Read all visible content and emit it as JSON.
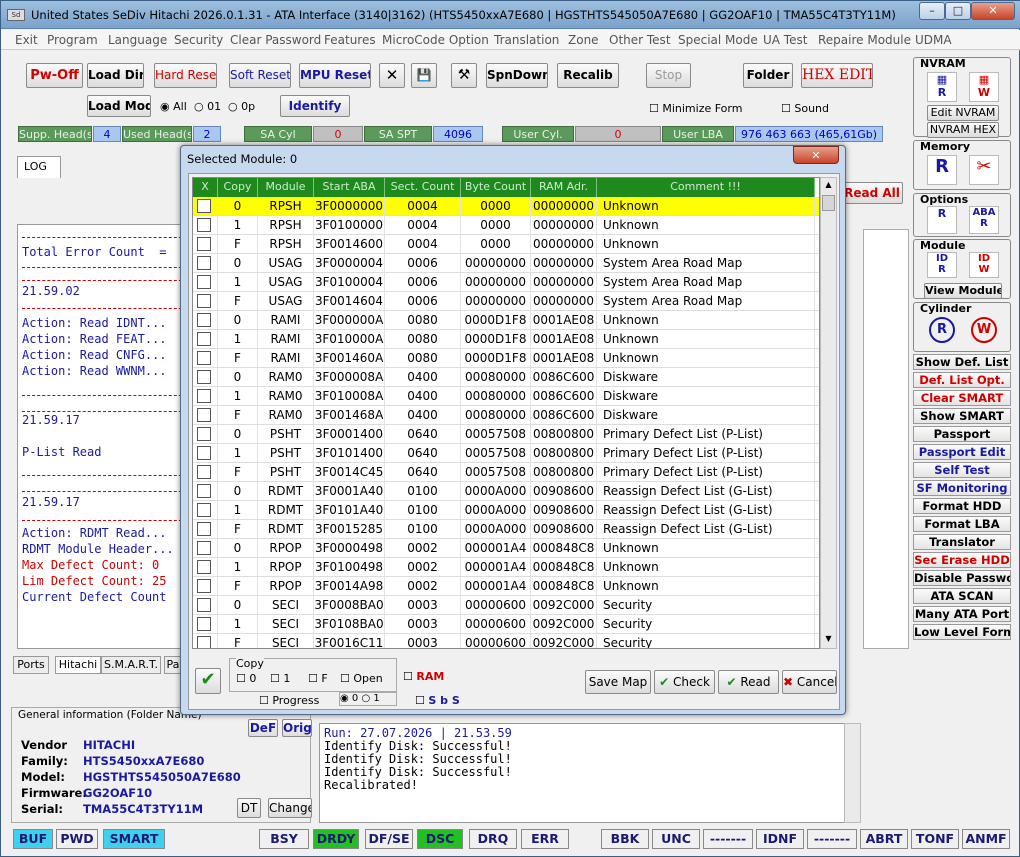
{
  "window": {
    "title": "United States  SeDiv Hitachi  2026.0.1.31 - ATA Interface  (3140|3162) (HTS5450xxA7E680 | HGSTHTS545050A7E680 | GG2OAF10 | TMA55C4T3TY11M)",
    "icon": "app-icon",
    "minimize": "–",
    "maximize": "□",
    "close": "✕"
  },
  "menu": [
    "Exit",
    "Program",
    "Language",
    "Security",
    "Clear Password",
    "Features",
    "MicroCode Option",
    "Translation",
    "Zone",
    "Other Test",
    "Special Mode",
    "UA Test",
    "Repaire Module",
    "UDMA"
  ],
  "toolbar": {
    "pwoff": "Pw-Off",
    "loaddir": "Load Dir",
    "hardreset": "Hard Reset",
    "softreset": "Soft Reset",
    "mpureset": "MPU Reset",
    "close": "✕",
    "save": "💾",
    "tools": "⚒",
    "spndown": "SpnDown",
    "recalib": "Recalib",
    "stop": "Stop",
    "folder": "Folder",
    "hexedit": "HEX EDIT",
    "loadmod": "Load Mod",
    "all": "All",
    "o01": "01",
    "o0p": "0p",
    "identify": "Identify",
    "minimize_form": "Minimize Form",
    "sound": "Sound"
  },
  "infobar": {
    "supp_label": "Supp. Head(s)",
    "supp_val": "4",
    "used_label": "Used Head(s)",
    "used_val": "2",
    "sacyl_label": "SA Cyl",
    "sacyl_val": "0",
    "saspt_label": "SA SPT",
    "saspt_val": "4096",
    "usercyl_label": "User Cyl.",
    "usercyl_val": "0",
    "userlba_label": "User LBA",
    "userlba_val": "976 463 663  (465,61Gb)"
  },
  "log_tab": "LOG",
  "read_all": "Read All",
  "log_lines": [
    {
      "t": "Total Error Count  =",
      "c": "#1a1aa0"
    },
    {
      "t": "21.59.02",
      "c": "#1a1aa0"
    },
    {
      "t": "Action: Read IDNT...",
      "c": "#1a1aa0"
    },
    {
      "t": "Action: Read FEAT...",
      "c": "#1a1aa0"
    },
    {
      "t": "Action: Read CNFG...",
      "c": "#1a1aa0"
    },
    {
      "t": "Action: Read WWNM...",
      "c": "#1a1aa0"
    },
    {
      "t": "21.59.17",
      "c": "#1a1aa0"
    },
    {
      "t": "P-List Read",
      "c": "#1a1aa0"
    },
    {
      "t": "21.59.17",
      "c": "#1a1aa0"
    },
    {
      "t": "Action: RDMT Read...",
      "c": "#1a1aa0"
    },
    {
      "t": "RDMT Module Header...",
      "c": "#1a1aa0"
    },
    {
      "t": "Max Defect Count: 0",
      "c": "#d00000"
    },
    {
      "t": "Lim Defect Count: 25",
      "c": "#d00000"
    },
    {
      "t": "Current Defect Count",
      "c": "#1a1aa0"
    }
  ],
  "bottom_tabs": [
    "Ports",
    "Hitachi",
    "S.M.A.R.T.",
    "Pa"
  ],
  "general": {
    "title": "General information (Folder Name)",
    "def": "DeF",
    "orig": "Orig",
    "vendor_label": "Vendor",
    "vendor": "HITACHI",
    "family_label": "Family:",
    "family": "HTS5450xxA7E680",
    "model_label": "Model:",
    "model": "HGSTHTS545050A7E680",
    "firmware_label": "Firmware:",
    "firmware": "GG2OAF10",
    "serial_label": "Serial:",
    "serial": "TMA55C4T3TY11M",
    "dt": "DT",
    "change": "Change"
  },
  "console": [
    "Run: 27.07.2026 | 21.53.59",
    "Identify Disk: Successful!",
    "Identify Disk: Successful!",
    "Identify Disk: Successful!",
    "Recalibrated!"
  ],
  "right": {
    "nvram": "NVRAM",
    "edit_nvram": "Edit NVRAM",
    "nvram_hex": "NVRAM HEX",
    "memory": "Memory",
    "options": "Options",
    "module": "Module",
    "view_module": "View Module",
    "cylinder": "Cylinder",
    "buttons": [
      {
        "t": "Show Def. List",
        "c": "#000"
      },
      {
        "t": "Def. List Opt.",
        "c": "#d00000"
      },
      {
        "t": "Clear SMART",
        "c": "#d00000"
      },
      {
        "t": "Show SMART",
        "c": "#000"
      },
      {
        "t": "Passport",
        "c": "#000"
      },
      {
        "t": "Passport Edit",
        "c": "#1a1aa0"
      },
      {
        "t": "Self Test",
        "c": "#1a1aa0"
      },
      {
        "t": "SF Monitoring",
        "c": "#1a1aa0"
      },
      {
        "t": "Format HDD",
        "c": "#000"
      },
      {
        "t": "Format LBA",
        "c": "#000"
      },
      {
        "t": "Translator",
        "c": "#000"
      },
      {
        "t": "Sec Erase HDD",
        "c": "#d00000"
      },
      {
        "t": "Disable Password",
        "c": "#000"
      },
      {
        "t": "ATA SCAN",
        "c": "#000"
      },
      {
        "t": "Many ATA Port",
        "c": "#000"
      },
      {
        "t": "Low Level Format",
        "c": "#000"
      }
    ]
  },
  "status": [
    {
      "t": "BUF",
      "bg": "#3fd0f0"
    },
    {
      "t": "PWD",
      "bg": "#f0f0f0"
    },
    {
      "t": "SMART",
      "bg": "#3fd0f0"
    },
    {
      "t": "BSY",
      "bg": "#f0f0f0"
    },
    {
      "t": "DRDY",
      "bg": "#22c022"
    },
    {
      "t": "DF/SE",
      "bg": "#f0f0f0"
    },
    {
      "t": "DSC",
      "bg": "#22c022"
    },
    {
      "t": "DRQ",
      "bg": "#f0f0f0"
    },
    {
      "t": "ERR",
      "bg": "#f0f0f0"
    },
    {
      "t": "BBK",
      "bg": "#f0f0f0"
    },
    {
      "t": "UNC",
      "bg": "#f0f0f0"
    },
    {
      "t": "-------",
      "bg": "#f0f0f0"
    },
    {
      "t": "IDNF",
      "bg": "#f0f0f0"
    },
    {
      "t": "-------",
      "bg": "#f0f0f0"
    },
    {
      "t": "ABRT",
      "bg": "#f0f0f0"
    },
    {
      "t": "TONF",
      "bg": "#f0f0f0"
    },
    {
      "t": "ANMF",
      "bg": "#f0f0f0"
    }
  ],
  "dialog": {
    "title": "Selected Module: 0",
    "close": "✕",
    "columns": [
      "X",
      "Copy",
      "Module",
      "Start ABA",
      "Sect. Count",
      "Byte Count",
      "RAM Adr.",
      "Comment !!!"
    ],
    "rows": [
      [
        "0",
        "RPSH",
        "3F0000000",
        "0004",
        "0000",
        "00000000",
        "Unknown"
      ],
      [
        "1",
        "RPSH",
        "3F0100000",
        "0004",
        "0000",
        "00000000",
        "Unknown"
      ],
      [
        "F",
        "RPSH",
        "3F0014600",
        "0004",
        "0000",
        "00000000",
        "Unknown"
      ],
      [
        "0",
        "USAG",
        "3F0000004",
        "0006",
        "00000000",
        "00000000",
        "System Area Road Map"
      ],
      [
        "1",
        "USAG",
        "3F0100004",
        "0006",
        "00000000",
        "00000000",
        "System Area Road Map"
      ],
      [
        "F",
        "USAG",
        "3F0014604",
        "0006",
        "00000000",
        "00000000",
        "System Area Road Map"
      ],
      [
        "0",
        "RAMI",
        "3F000000A",
        "0080",
        "0000D1F8",
        "0001AE08",
        "Unknown"
      ],
      [
        "1",
        "RAMI",
        "3F010000A",
        "0080",
        "0000D1F8",
        "0001AE08",
        "Unknown"
      ],
      [
        "F",
        "RAMI",
        "3F001460A",
        "0080",
        "0000D1F8",
        "0001AE08",
        "Unknown"
      ],
      [
        "0",
        "RAM0",
        "3F000008A",
        "0400",
        "00080000",
        "0086C600",
        "Diskware"
      ],
      [
        "1",
        "RAM0",
        "3F010008A",
        "0400",
        "00080000",
        "0086C600",
        "Diskware"
      ],
      [
        "F",
        "RAM0",
        "3F001468A",
        "0400",
        "00080000",
        "0086C600",
        "Diskware"
      ],
      [
        "0",
        "PSHT",
        "3F0001400",
        "0640",
        "00057508",
        "00800800",
        "Primary Defect List (P-List)"
      ],
      [
        "1",
        "PSHT",
        "3F0101400",
        "0640",
        "00057508",
        "00800800",
        "Primary Defect List (P-List)"
      ],
      [
        "F",
        "PSHT",
        "3F0014C45",
        "0640",
        "00057508",
        "00800800",
        "Primary Defect List (P-List)"
      ],
      [
        "0",
        "RDMT",
        "3F0001A40",
        "0100",
        "0000A000",
        "00908600",
        "Reassign Defect List (G-List)"
      ],
      [
        "1",
        "RDMT",
        "3F0101A40",
        "0100",
        "0000A000",
        "00908600",
        "Reassign Defect List (G-List)"
      ],
      [
        "F",
        "RDMT",
        "3F0015285",
        "0100",
        "0000A000",
        "00908600",
        "Reassign Defect List (G-List)"
      ],
      [
        "0",
        "RPOP",
        "3F0000498",
        "0002",
        "000001A4",
        "000848C8",
        "Unknown"
      ],
      [
        "1",
        "RPOP",
        "3F0100498",
        "0002",
        "000001A4",
        "000848C8",
        "Unknown"
      ],
      [
        "F",
        "RPOP",
        "3F0014A98",
        "0002",
        "000001A4",
        "000848C8",
        "Unknown"
      ],
      [
        "0",
        "SECI",
        "3F0008BA0",
        "0003",
        "00000600",
        "0092C000",
        "Security"
      ],
      [
        "1",
        "SECI",
        "3F0108BA0",
        "0003",
        "00000600",
        "0092C000",
        "Security"
      ],
      [
        "F",
        "SECI",
        "3F0016C11",
        "0003",
        "00000600",
        "0092C000",
        "Security"
      ]
    ],
    "copy_label": "Copy",
    "c0": "0",
    "c1": "1",
    "cf": "F",
    "open": "Open",
    "ram": "RAM",
    "progress": "Progress",
    "r0": "0",
    "r1": "1",
    "sbs": "S b S",
    "save_map": "Save Map",
    "check": "Check",
    "read": "Read",
    "cancel": "Cancel"
  },
  "colors": {
    "highlight": "#ffff00",
    "grid_header": "#1e8a1e"
  }
}
